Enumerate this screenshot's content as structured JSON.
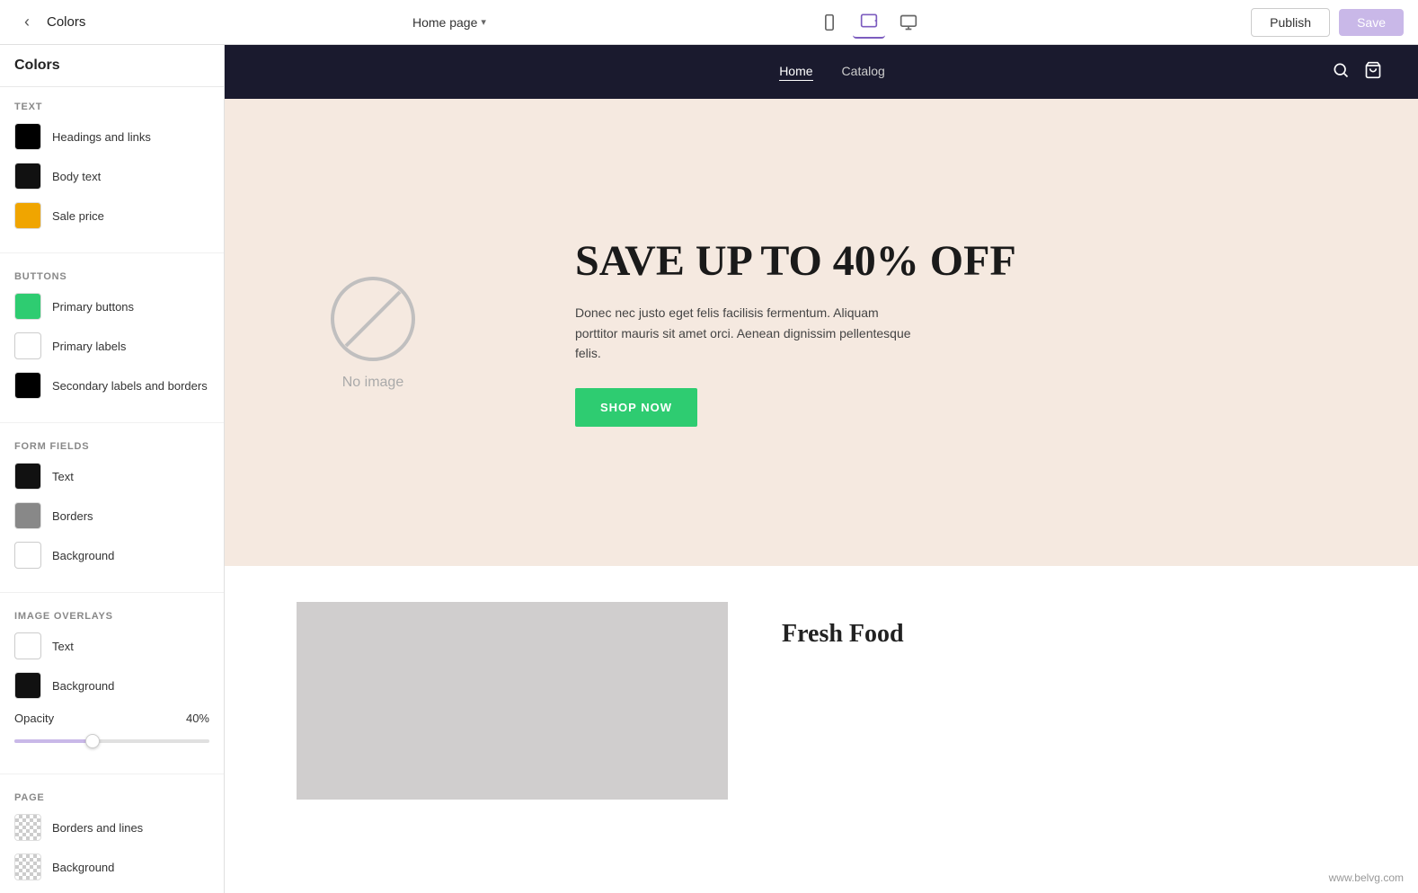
{
  "topbar": {
    "back_label": "‹",
    "page_title": "Colors",
    "page_selector": "Home page",
    "chevron": "▾",
    "publish_label": "Publish",
    "save_label": "Save",
    "devices": [
      {
        "name": "mobile",
        "icon": "📱",
        "active": false
      },
      {
        "name": "tablet",
        "icon": "💻",
        "active": true
      },
      {
        "name": "desktop",
        "icon": "🖥",
        "active": false
      }
    ]
  },
  "sidebar": {
    "title": "Colors",
    "sections": {
      "text": {
        "label": "TEXT",
        "items": [
          {
            "label": "Headings and links",
            "color": "#000000",
            "transparent": false
          },
          {
            "label": "Body text",
            "color": "#111111",
            "transparent": false
          },
          {
            "label": "Sale price",
            "color": "#f0a500",
            "transparent": false
          }
        ]
      },
      "buttons": {
        "label": "BUTTONS",
        "items": [
          {
            "label": "Primary buttons",
            "color": "#2ecc71",
            "transparent": false
          },
          {
            "label": "Primary labels",
            "color": "#ffffff",
            "transparent": false,
            "border": true
          },
          {
            "label": "Secondary labels and borders",
            "color": "#000000",
            "transparent": false
          }
        ]
      },
      "form_fields": {
        "label": "FORM FIELDS",
        "items": [
          {
            "label": "Text",
            "color": "#111111",
            "transparent": false
          },
          {
            "label": "Borders",
            "color": "#888888",
            "transparent": false
          },
          {
            "label": "Background",
            "color": "#ffffff",
            "transparent": false,
            "border": true
          }
        ]
      },
      "image_overlays": {
        "label": "IMAGE OVERLAYS",
        "items": [
          {
            "label": "Text",
            "color": "#ffffff",
            "transparent": false,
            "border": true
          },
          {
            "label": "Background",
            "color": "#111111",
            "transparent": false
          }
        ],
        "opacity": {
          "label": "Opacity",
          "value": "40%",
          "percent": 40
        }
      },
      "page": {
        "label": "PAGE",
        "items": [
          {
            "label": "Borders and lines",
            "color": "checker",
            "transparent": true
          },
          {
            "label": "Background",
            "color": "checker",
            "transparent": true
          }
        ]
      }
    }
  },
  "preview": {
    "nav": {
      "links": [
        "Home",
        "Catalog"
      ],
      "active_link": "Home"
    },
    "hero": {
      "no_image_text": "No image",
      "title": "SAVE UP TO 40% OFF",
      "description": "Donec nec justo eget felis facilisis fermentum. Aliquam porttitor mauris sit amet orci. Aenean dignissim pellentesque felis.",
      "button_label": "SHOP NOW"
    },
    "second": {
      "title": "Fresh Food"
    },
    "watermark": "www.belvg.com"
  }
}
